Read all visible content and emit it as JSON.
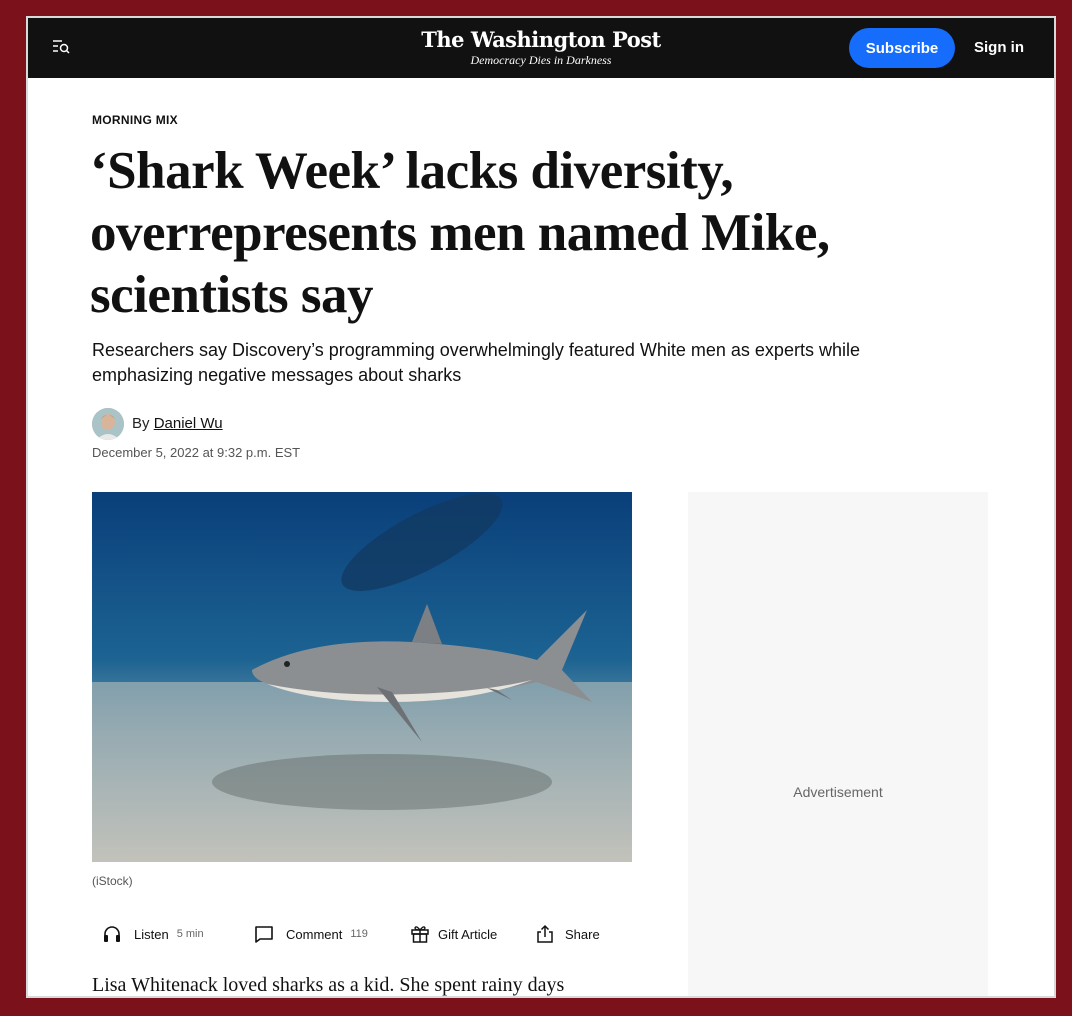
{
  "header": {
    "logo_title": "The Washington Post",
    "logo_tagline": "Democracy Dies in Darkness",
    "subscribe_label": "Subscribe",
    "signin_label": "Sign in"
  },
  "article": {
    "kicker": "MORNING MIX",
    "headline": "‘Shark Week’ lacks diversity, overrepresents men named Mike, scientists say",
    "dek": "Researchers say Discovery’s programming overwhelmingly featured White men as experts while emphasizing negative messages about sharks",
    "byline_prefix": "By",
    "author": "Daniel Wu",
    "date": "December 5, 2022 at 9:32 p.m. EST",
    "image_caption": "(iStock)",
    "body_first_line": "Lisa Whitenack loved sharks as a kid. She spent rainy days"
  },
  "actions": {
    "listen_label": "Listen",
    "listen_meta": "5 min",
    "comment_label": "Comment",
    "comment_count": "119",
    "gift_label": "Gift Article",
    "share_label": "Share"
  },
  "ad": {
    "label": "Advertisement"
  },
  "colors": {
    "page_border": "#7b111b",
    "topbar": "#111111",
    "subscribe_button": "#166dfc",
    "ad_background": "#f7f7f7"
  },
  "icons": [
    "menu-search-icon",
    "headphones-icon",
    "comment-icon",
    "gift-icon",
    "share-icon"
  ]
}
